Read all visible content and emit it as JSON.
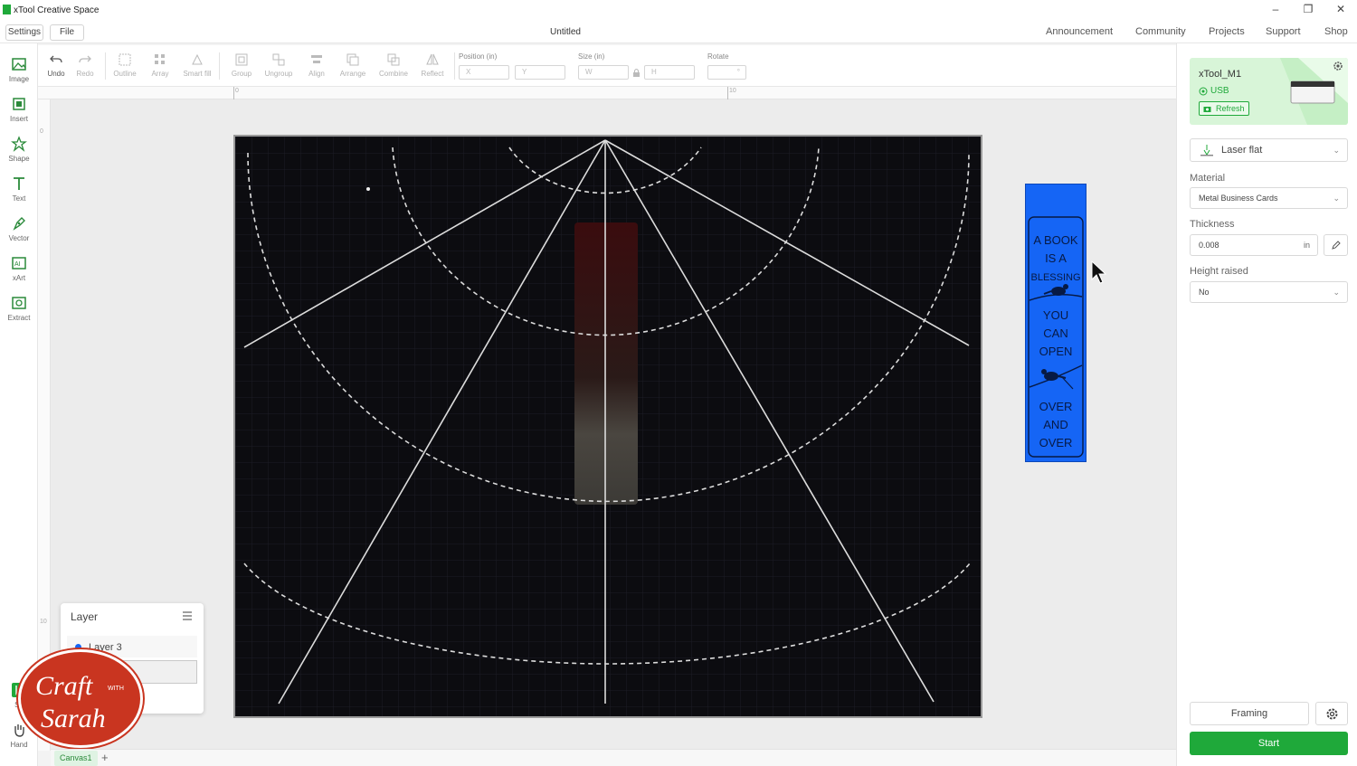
{
  "app": {
    "title": "xTool Creative Space",
    "document_title": "Untitled"
  },
  "menu": {
    "settings": "Settings",
    "file": "File"
  },
  "nav": [
    "Announcement",
    "Community",
    "Projects",
    "Support",
    "Shop"
  ],
  "window_controls": {
    "minimize": "–",
    "restore": "❐",
    "close": "✕"
  },
  "toolbar": {
    "tools": [
      "Undo",
      "Redo",
      "Outline",
      "Array",
      "Smart fill",
      "Group",
      "Ungroup",
      "Align",
      "Arrange",
      "Combine",
      "Reflect"
    ],
    "position_label": "Position (in)",
    "size_label": "Size (in)",
    "rotate_label": "Rotate",
    "x_placeholder": "X",
    "y_placeholder": "Y",
    "w_placeholder": "W",
    "h_placeholder": "H",
    "rotate_value": "°"
  },
  "sidebar": [
    "Image",
    "Insert",
    "Shape",
    "Text",
    "Vector",
    "xArt",
    "Extract"
  ],
  "sidebar_bottom": [
    "Se",
    "Hand"
  ],
  "rulers": {
    "h": [
      "0",
      "10"
    ],
    "v": [
      "0",
      "10"
    ]
  },
  "bookmark_text": [
    "A BOOK",
    "IS A",
    "BLESSING",
    "YOU",
    "CAN",
    "OPEN",
    "OVER",
    "AND",
    "OVER"
  ],
  "device": {
    "name": "xTool_M1",
    "connection": "USB",
    "refresh": "Refresh"
  },
  "mode": "Laser flat",
  "material": {
    "label": "Material",
    "value": "Metal Business Cards"
  },
  "thickness": {
    "label": "Thickness",
    "value": "0.008",
    "unit": "in"
  },
  "height_raised": {
    "label": "Height raised",
    "value": "No"
  },
  "actions": {
    "framing": "Framing",
    "start": "Start"
  },
  "layer": {
    "title": "Layer",
    "name": "Layer 3"
  },
  "canvas_tab": "Canvas1",
  "add_tab": "+",
  "logo": {
    "line1": "Craft",
    "with": "WITH",
    "line2": "Sarah"
  },
  "colors": {
    "accent_green": "#1fa93a",
    "bookmark_blue": "#1565f5"
  }
}
